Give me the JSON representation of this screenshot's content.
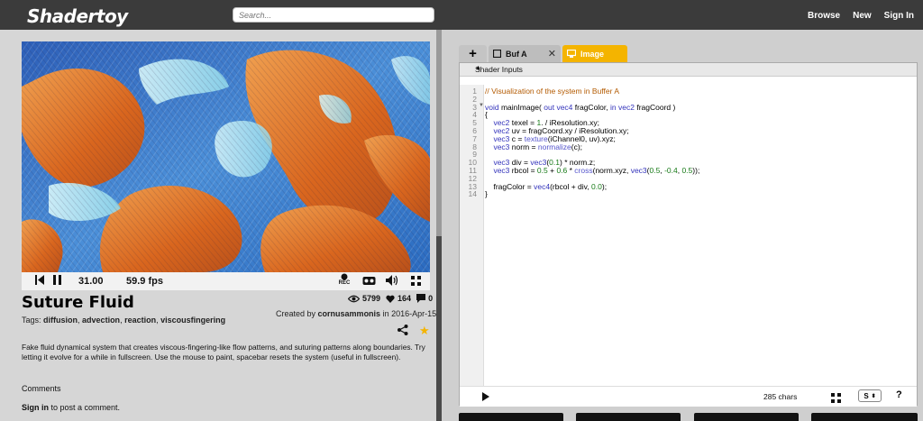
{
  "header": {
    "logo": "Shadertoy",
    "search_placeholder": "Search...",
    "nav": [
      "Browse",
      "New",
      "Sign In"
    ]
  },
  "player": {
    "time": "31.00",
    "fps": "59.9 fps",
    "rec_label": "REC"
  },
  "shader": {
    "title": "Suture Fluid",
    "views": "5799",
    "likes": "164",
    "comments_count": "0",
    "created_prefix": "Created by",
    "author": "cornusammonis",
    "created_mid": "in",
    "date": "2016-Apr-15",
    "tags_label": "Tags:",
    "tags": [
      "diffusion",
      "advection",
      "reaction",
      "viscousfingering"
    ],
    "description": "Fake fluid dynamical system that creates viscous-fingering-like flow patterns, and suturing patterns along boundaries. Try letting it evolve for a while in fullscreen. Use the mouse to paint, spacebar resets the system (useful in fullscreen)."
  },
  "comments": {
    "heading": "Comments",
    "signin_link": "Sign in",
    "signin_rest": " to post a comment."
  },
  "editor": {
    "tabs": [
      "+",
      "Buf A",
      "Image"
    ],
    "shader_inputs_label": "Shader Inputs",
    "line_numbers": [
      "1",
      "2",
      "3",
      "4",
      "5",
      "6",
      "7",
      "8",
      "9",
      "10",
      "11",
      "12",
      "13",
      "14"
    ],
    "chars": "285 chars",
    "select_value": "S",
    "help": "?",
    "code_lines": [
      "// Visualization of the system in Buffer A",
      "",
      "void mainImage( out vec4 fragColor, in vec2 fragCoord )",
      "{",
      "    vec2 texel = 1. / iResolution.xy;",
      "    vec2 uv = fragCoord.xy / iResolution.xy;",
      "    vec3 c = texture(iChannel0, uv).xyz;",
      "    vec3 norm = normalize(c);",
      "",
      "    vec3 div = vec3(0.1) * norm.z;",
      "    vec3 rbcol = 0.5 + 0.6 * cross(norm.xyz, vec3(0.5, -0.4, 0.5));",
      "",
      "    fragColor = vec4(rbcol + div, 0.0);",
      "}"
    ]
  },
  "colors": {
    "accent": "#f4b400",
    "topbar": "#3b3b3b",
    "fluid_blue": "#3f7fd0",
    "fluid_orange": "#e07a28",
    "fluid_cyan": "#a8e8f2"
  }
}
